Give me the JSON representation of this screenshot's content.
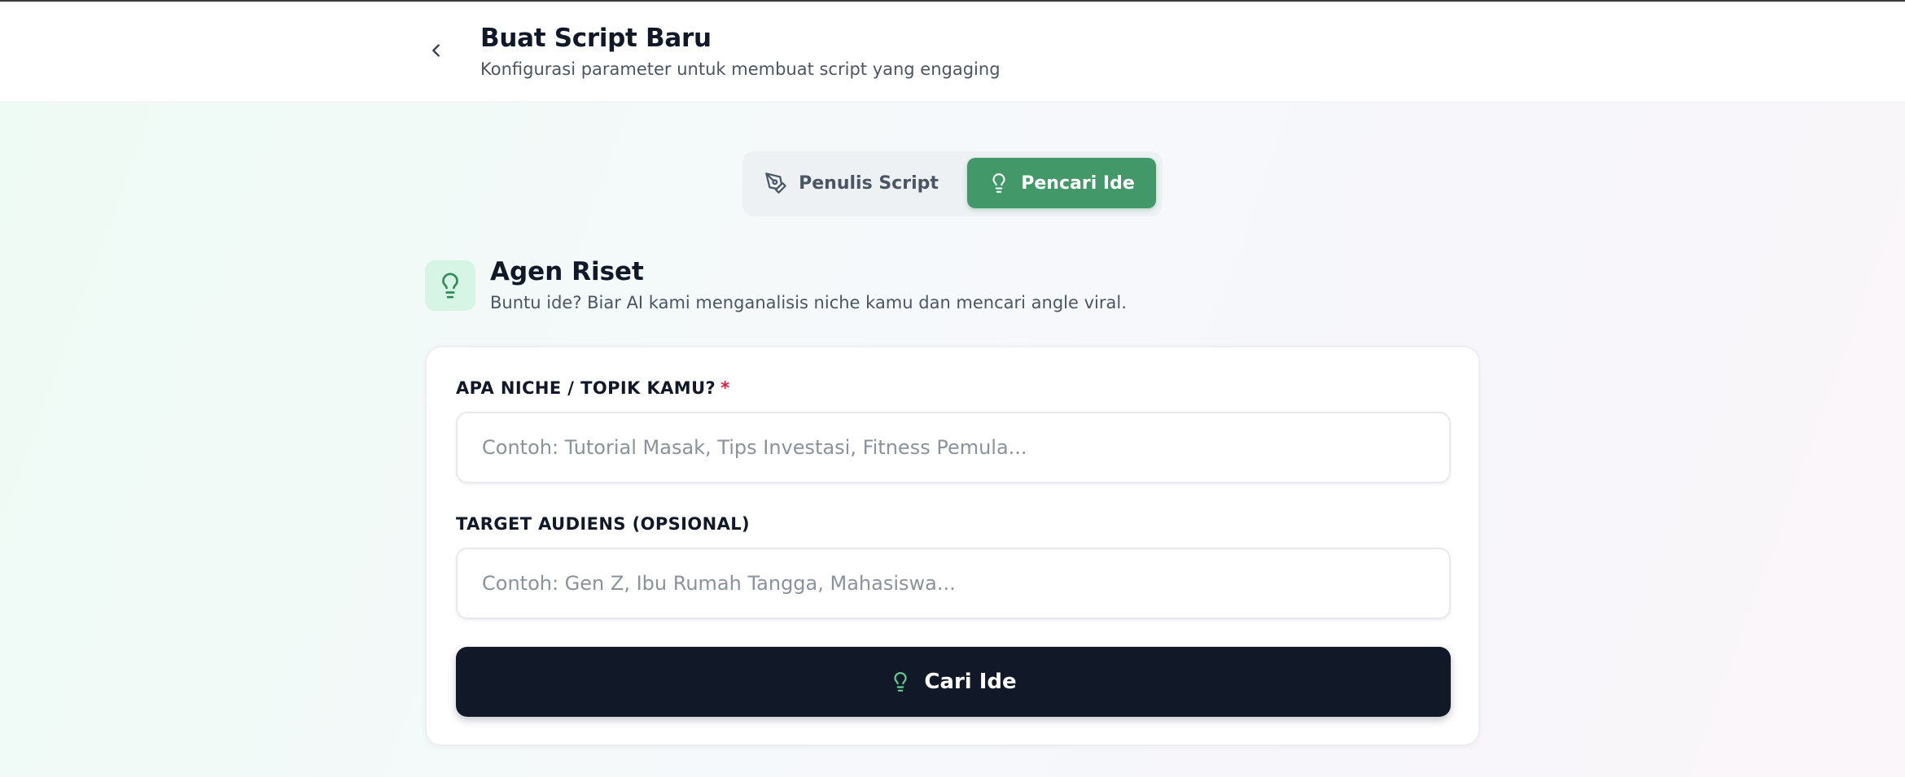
{
  "header": {
    "title": "Buat Script Baru",
    "subtitle": "Konfigurasi parameter untuk membuat script yang engaging"
  },
  "mode_toggle": {
    "options": [
      {
        "label": "Penulis Script",
        "icon": "pen-tool-icon",
        "active": false
      },
      {
        "label": "Pencari Ide",
        "icon": "lightbulb-icon",
        "active": true
      }
    ]
  },
  "section": {
    "title": "Agen Riset",
    "description": "Buntu ide? Biar AI kami menganalisis niche kamu dan mencari angle viral.",
    "icon": "lightbulb-icon"
  },
  "form": {
    "niche": {
      "label": "APA NICHE / TOPIK KAMU?",
      "required_mark": "*",
      "value": "",
      "placeholder": "Contoh: Tutorial Masak, Tips Investasi, Fitness Pemula..."
    },
    "audience": {
      "label": "TARGET AUDIENS (OPSIONAL)",
      "value": "",
      "placeholder": "Contoh: Gen Z, Ibu Rumah Tangga, Mahasiswa..."
    },
    "submit_label": "Cari Ide"
  },
  "colors": {
    "accent_green": "#43986a",
    "icon_bg_green": "#d7f5e5",
    "dark_button": "#111827",
    "required_red": "#e11d48"
  }
}
